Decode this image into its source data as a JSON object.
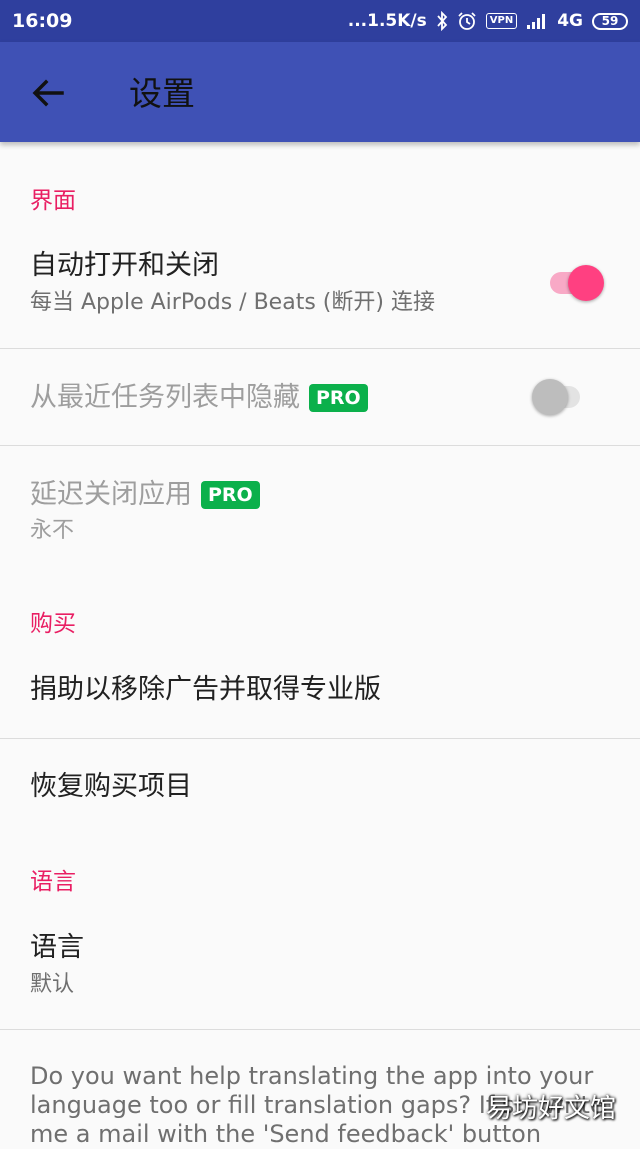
{
  "status_bar": {
    "time": "16:09",
    "network_speed": "...1.5K/s",
    "vpn": "VPN",
    "network_type": "4G",
    "battery": "59",
    "icons": [
      "bluetooth-icon",
      "alarm-icon",
      "vpn-icon",
      "signal-icon",
      "battery-icon"
    ]
  },
  "app_bar": {
    "title": "设置",
    "back_icon": "arrow-left-icon",
    "background": "#3f51b5"
  },
  "sections": {
    "interface": {
      "header": "界面",
      "auto_open_close": {
        "title": "自动打开和关闭",
        "summary": "每当 Apple AirPods / Beats (断开) 连接",
        "enabled": true
      },
      "hide_recents": {
        "title": "从最近任务列表中隐藏",
        "badge": "PRO",
        "enabled": false
      },
      "delay_close": {
        "title": "延迟关闭应用",
        "badge": "PRO",
        "summary": "永不"
      }
    },
    "purchase": {
      "header": "购买",
      "donate": {
        "title": "捐助以移除广告并取得专业版"
      },
      "restore": {
        "title": "恢复购买项目"
      }
    },
    "language": {
      "header": "语言",
      "language": {
        "title": "语言",
        "summary": "默认"
      }
    }
  },
  "help_text": "Do you want help translating the app into your language too or fill translation gaps? If so, write me a mail with the 'Send feedback' button",
  "watermark": "易坊好文馆",
  "colors": {
    "accent": "#e91e63",
    "switch_on": "#ff4081",
    "pro_badge": "#0bb04b",
    "status_bar": "#2f3f9e"
  }
}
